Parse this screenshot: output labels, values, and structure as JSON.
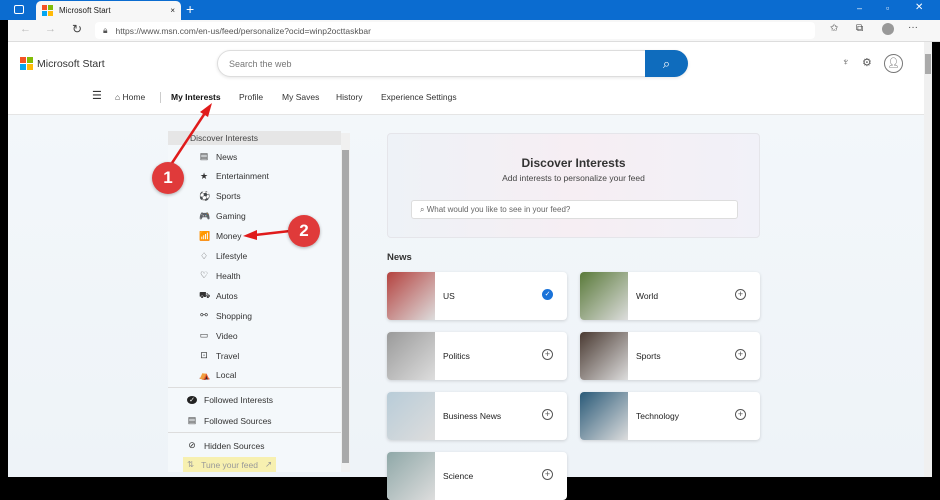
{
  "browser": {
    "tab_title": "Microsoft Start",
    "url": "https://www.msn.com/en-us/feed/personalize?ocid=winp2octtaskbar",
    "new_tab": "+",
    "close": "×"
  },
  "header": {
    "brand": "Microsoft Start",
    "search_placeholder": "Search the web"
  },
  "nav": {
    "home": "Home",
    "items": [
      "My Interests",
      "Profile",
      "My Saves",
      "History",
      "Experience Settings"
    ]
  },
  "sidebar": {
    "header": "Discover Interests",
    "items": [
      {
        "label": "News",
        "icon": "▤"
      },
      {
        "label": "Entertainment",
        "icon": "★"
      },
      {
        "label": "Sports",
        "icon": "⚽"
      },
      {
        "label": "Gaming",
        "icon": "🎮"
      },
      {
        "label": "Money",
        "icon": "📶"
      },
      {
        "label": "Lifestyle",
        "icon": "♢"
      },
      {
        "label": "Health",
        "icon": "♡"
      },
      {
        "label": "Autos",
        "icon": "⛟"
      },
      {
        "label": "Shopping",
        "icon": "⚯"
      },
      {
        "label": "Video",
        "icon": "▭"
      },
      {
        "label": "Travel",
        "icon": "⊡"
      },
      {
        "label": "Local",
        "icon": "⛺"
      }
    ],
    "followed_interests": "Followed Interests",
    "followed_sources": "Followed Sources",
    "hidden_sources": "Hidden Sources",
    "tune_feed": "Tune your feed"
  },
  "discover": {
    "title": "Discover Interests",
    "subtitle": "Add interests to personalize your feed",
    "placeholder": "What would you like to see in your feed?"
  },
  "news": {
    "heading": "News",
    "cards": [
      {
        "label": "US",
        "followed": true,
        "color": "#b4423f"
      },
      {
        "label": "World",
        "followed": false,
        "color": "#5a7a3a"
      },
      {
        "label": "Politics",
        "followed": false,
        "color": "#9a9a9a"
      },
      {
        "label": "Sports",
        "followed": false,
        "color": "#4a3a32"
      },
      {
        "label": "Business News",
        "followed": false,
        "color": "#b8ccd8"
      },
      {
        "label": "Technology",
        "followed": false,
        "color": "#2a5a78"
      },
      {
        "label": "Science",
        "followed": false,
        "color": "#8fa8a8"
      }
    ]
  },
  "annotations": [
    "1",
    "2"
  ],
  "accent": "#0f6cbd"
}
